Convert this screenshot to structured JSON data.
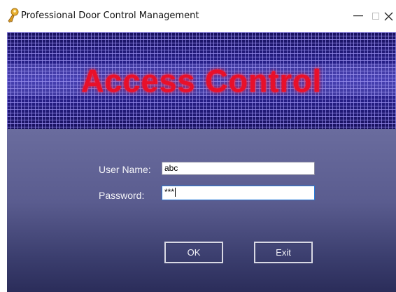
{
  "window": {
    "title": "Professional Door Control Management",
    "icon": "key-icon",
    "controls": {
      "minimize": "—",
      "maximize": "□",
      "close": "✕"
    }
  },
  "banner": {
    "text": "Access Control",
    "text_color": "#e8102a",
    "background_color": "#221b7a"
  },
  "form": {
    "username_label": "User Name:",
    "username_value": "abc",
    "password_label": "Password:",
    "password_value": "***"
  },
  "buttons": {
    "ok_label": "OK",
    "exit_label": "Exit"
  }
}
